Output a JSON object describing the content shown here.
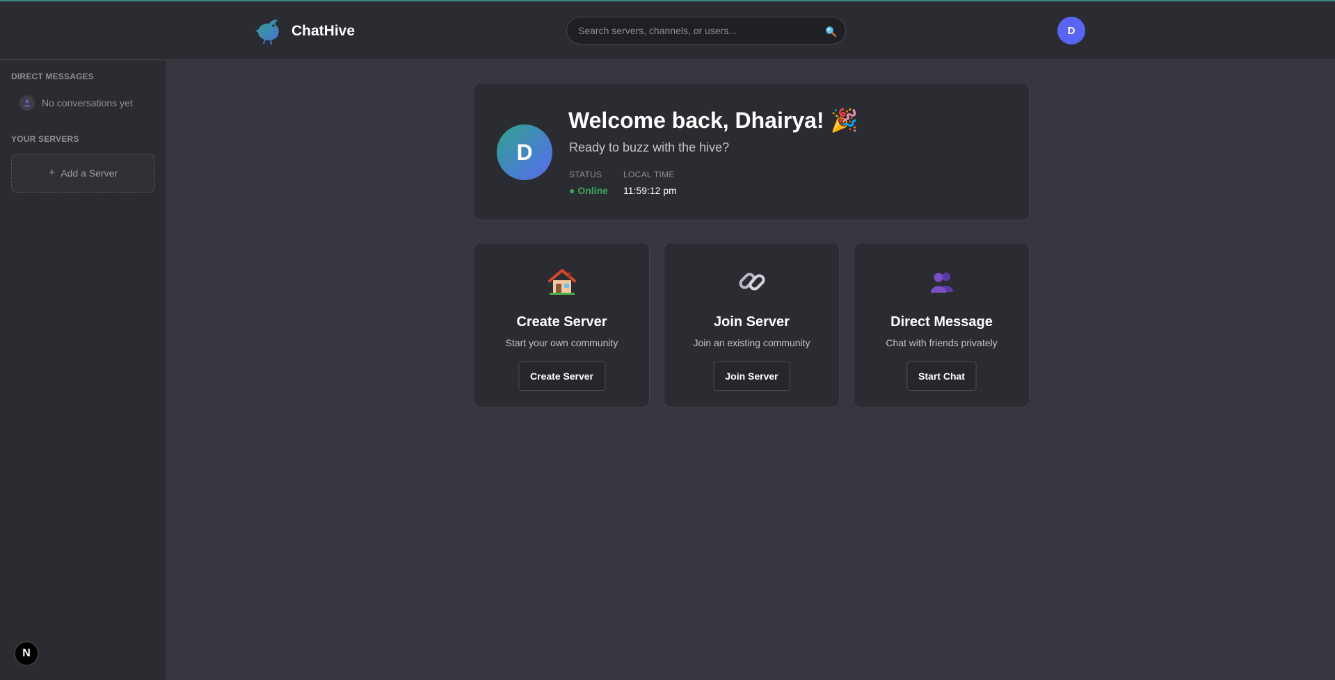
{
  "header": {
    "brand_name": "ChatHive",
    "search_placeholder": "Search servers, channels, or users...",
    "avatar_initial": "D"
  },
  "sidebar": {
    "direct_messages_title": "DIRECT MESSAGES",
    "no_conversations": "No conversations yet",
    "servers_title": "YOUR SERVERS",
    "add_server_label": "Add a Server",
    "add_server_icon": "+"
  },
  "welcome": {
    "avatar_initial": "D",
    "title": "Welcome back, Dhairya! 🎉",
    "subtitle": "Ready to buzz with the hive?",
    "status_label": "STATUS",
    "status_value": "● Online",
    "time_label": "LOCAL TIME",
    "time_value": "11:59:12 pm"
  },
  "actions": [
    {
      "icon": "🏠",
      "icon_name": "house-icon",
      "title": "Create Server",
      "desc": "Start your own community",
      "button": "Create Server"
    },
    {
      "icon": "🔗",
      "icon_name": "link-icon",
      "title": "Join Server",
      "desc": "Join an existing community",
      "button": "Join Server"
    },
    {
      "icon": "👥",
      "icon_name": "users-icon",
      "title": "Direct Message",
      "desc": "Chat with friends privately",
      "button": "Start Chat"
    }
  ],
  "dev_badge": "N",
  "colors": {
    "accent": "#5865f2",
    "online": "#3ba55c",
    "background": "#36373e",
    "panel": "#2b2c31"
  }
}
